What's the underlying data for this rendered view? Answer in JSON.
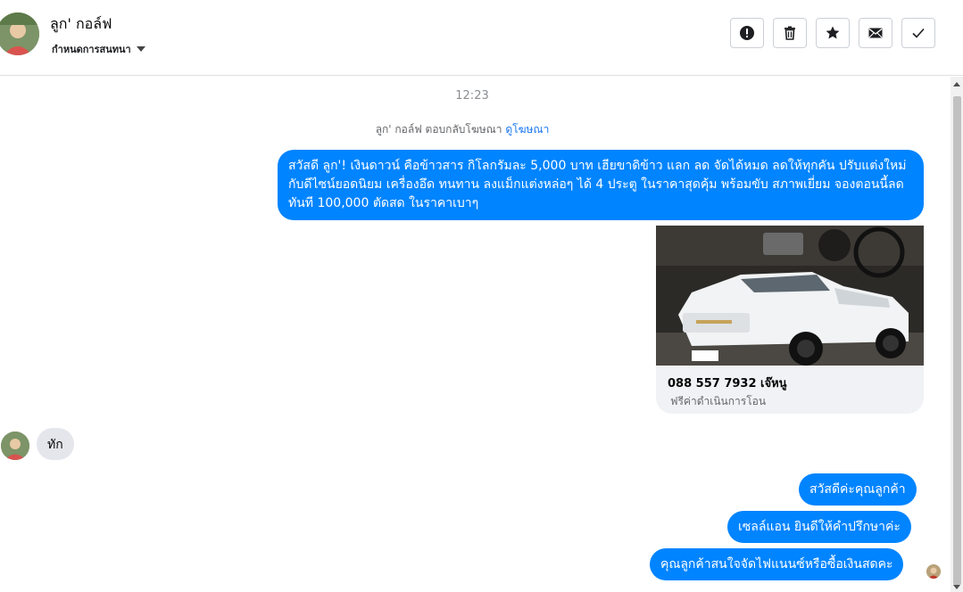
{
  "header": {
    "contact_name": "ลูก' กอล์ฟ",
    "assign_label": "กำหนดการสนทนา",
    "actions": [
      {
        "name": "mark-spam-button",
        "icon": "alert-icon"
      },
      {
        "name": "delete-button",
        "icon": "trash-icon"
      },
      {
        "name": "star-button",
        "icon": "star-icon"
      },
      {
        "name": "mark-unread-button",
        "icon": "envelope-icon"
      },
      {
        "name": "mark-done-button",
        "icon": "check-icon"
      }
    ]
  },
  "thread": {
    "timestamp": "12:23",
    "reply_note": "ลูก' กอล์ฟ ตอบกลับโฆษณา",
    "view_ad_link": "ดูโฆษณา",
    "ad_message": "สวัสดี ลูก'! เงินดาวน์ คือข้าวสาร กิโลกรัมละ 5,000 บาท เฮียขาดิข้าว แลก ลด จัดได้หมด ลดให้ทุกคัน ปรับแต่งใหม่ กับดีไซน์ยอดนิยม เครื่องอึด ทนทาน ลงแม็กแต่งหล่อๆ ได้ 4 ประตู ในราคาสุดคุ้ม พร้อมขับ สภาพเยี่ยม จองตอนนี้ลดทันที 100,000 ตัดสด ในราคาเบาๆ",
    "ad_card": {
      "title": "088 557 7932 เจ๊หนู",
      "subtitle": "ฟรีค่าดำเนินการโอน"
    },
    "incoming_message": "ทัก",
    "replies": [
      "สวัสดีค่ะคุณลูกค้า",
      "เซลล์แอน ยินดีให้คำปรึกษาค่ะ",
      "คุณลูกค้าสนใจจัดไฟแนนซ์หรือซื้อเงินสดคะ"
    ]
  },
  "colors": {
    "outgoing_bubble": "#0084ff",
    "incoming_bubble": "#e4e6eb",
    "link": "#1877f2"
  }
}
